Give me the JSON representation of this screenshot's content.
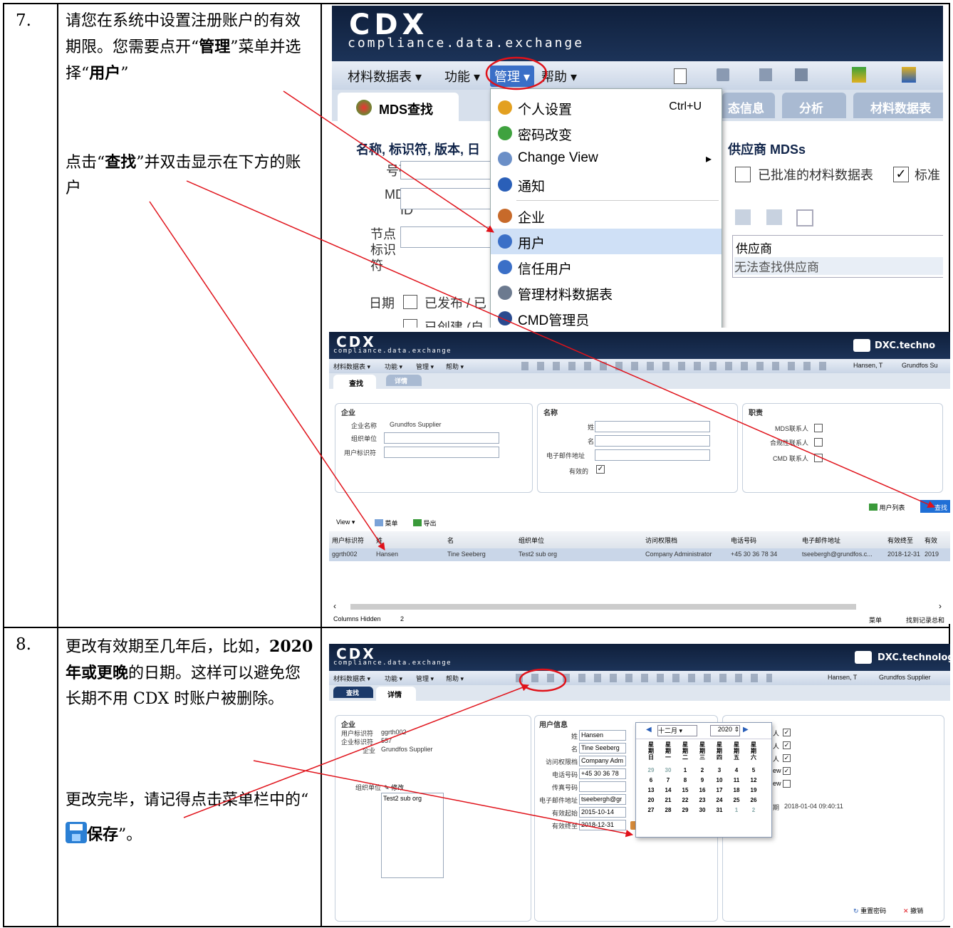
{
  "row7": {
    "number": "7.",
    "text_a_1": "请您在系统中设置注册账户的有效期限。您需要点开",
    "text_a_q1": "“",
    "text_a_b1": "管理",
    "text_a_2": "”菜单并选择",
    "text_a_q2": "“",
    "text_a_b2": "用户",
    "text_a_q3": "”",
    "text_b_1": "点击",
    "text_b_q1": "“",
    "text_b_b1": "查找",
    "text_b_2": "”并双击显示在下方的账户"
  },
  "row8": {
    "number": "8.",
    "text_a_1": "更改有效期至几年后，比如，",
    "text_a_b1": "2020 年或更晚",
    "text_a_2": "的日期。这样可以避免您长期不用 CDX 时账户被删除。",
    "text_b_1": "更改完毕，请记得点击菜单栏中的",
    "text_b_q1": "“",
    "text_b_b1": "保存",
    "text_b_2": "”。"
  },
  "logo": {
    "main": "CDX",
    "sub": "compliance.data.exchange",
    "brand": "DXC.techno",
    "brand2": "DXC.technolog"
  },
  "shot1": {
    "menu": [
      "材料数据表 ▾",
      "功能 ▾",
      "管理",
      "帮助 ▾"
    ],
    "tab_main": "MDS查找",
    "tab_info": "态信息",
    "tab_analysis": "分析",
    "tab_mds": "材料数据表",
    "section_title": "名称, 标识符, 版本, 日",
    "f_number": "号码",
    "f_mdsid": "MDS ID",
    "f_node": "节点标识符",
    "f_date": "日期",
    "f_published": "已发布 / 已",
    "f_created": "已创建 (自",
    "supplier_title": "供应商 MDSs",
    "approved": "已批准的材料数据表",
    "standard": "标准",
    "supplier_col": "供应商",
    "no_supplier": "无法查找供应商",
    "dropdown": [
      {
        "label": "个人设置",
        "shortcut": "Ctrl+U",
        "icon": "person-icon",
        "color": "#e3a020"
      },
      {
        "label": "密码改变",
        "shortcut": "",
        "icon": "key-people-icon",
        "color": "#3fa23f"
      },
      {
        "label": "Change View",
        "shortcut": "▸",
        "icon": "gear-icon",
        "color": "#6b8fc7"
      },
      {
        "label": "通知",
        "shortcut": "",
        "icon": "info-icon",
        "color": "#2a5fb8"
      },
      {
        "label": "企业",
        "shortcut": "",
        "icon": "home-icon",
        "color": "#c76a2a"
      },
      {
        "label": "用户",
        "shortcut": "",
        "icon": "user-icon",
        "color": "#3a6fc7"
      },
      {
        "label": "信任用户",
        "shortcut": "",
        "icon": "trusted-user-icon",
        "color": "#3a6fc7"
      },
      {
        "label": "管理材料数据表",
        "shortcut": "",
        "icon": "document-icon",
        "color": "#6c7a8f"
      },
      {
        "label": "CMD管理员",
        "shortcut": "",
        "icon": "admin-icon",
        "color": "#2a4a8f"
      }
    ]
  },
  "shot2": {
    "menu": [
      "材料数据表 ▾",
      "功能 ▾",
      "管理 ▾",
      "帮助 ▾"
    ],
    "user": "Hansen, T",
    "company": "Grundfos Su",
    "tab_find": "查找",
    "tab_detail": "详情",
    "p_company": "企业",
    "company_name_lbl": "企业名称",
    "company_name": "Grundfos Supplier",
    "org_lbl": "组织单位",
    "userid_lbl": "用户标识符",
    "p_name": "名称",
    "last_lbl": "姓",
    "first_lbl": "名",
    "email_lbl": "电子邮件地址",
    "valid_lbl": "有效的",
    "p_role": "职责",
    "role1": "MDS联系人",
    "role2": "合规性联系人",
    "role3": "CMD 联系人",
    "userlist": "用户列表",
    "find": "查找",
    "view": "View ▾",
    "menu_btn": "菜单",
    "export": "导出",
    "columns": [
      "用户标识符",
      "姓",
      "名",
      "组织单位",
      "访问权限档",
      "电话号码",
      "电子邮件地址",
      "有效终至",
      "有效"
    ],
    "row": [
      "ggrth002",
      "Hansen",
      "Tine Seeberg",
      "Test2 sub org",
      "Company Administrator",
      "+45 30 36 78 34",
      "tseebergh@grundfos.c...",
      "2018-12-31",
      "2019"
    ],
    "cols_hidden": "Columns Hidden",
    "cols_hidden_n": "2",
    "footer_menu": "菜单",
    "footer_total": "找到记录总和"
  },
  "shot3": {
    "menu": [
      "材料数据表 ▾",
      "功能 ▾",
      "管理 ▾",
      "帮助 ▾"
    ],
    "user": "Hansen, T",
    "company": "Grundfos Supplier",
    "tab_find": "查找",
    "tab_detail": "详情",
    "p_company": "企业",
    "userid_lbl": "用户标识符",
    "userid": "ggrth002",
    "compid_lbl": "企业标识符",
    "compid": "557",
    "comp_lbl": "企业",
    "comp": "Grundfos Supplier",
    "org_lbl": "组织单位",
    "edit": "修改",
    "org_val": "Test2 sub org",
    "p_user": "用户信息",
    "last_lbl": "姓",
    "last": "Hansen",
    "first_lbl": "名",
    "first": "Tine Seeberg",
    "access_lbl": "访问权限档",
    "access": "Company Adm",
    "phone_lbl": "电话号码",
    "phone": "+45 30 36 78",
    "fax_lbl": "传真号码",
    "email_lbl": "电子邮件地址",
    "email": "tseebergh@gr",
    "from_lbl": "有效起始",
    "from": "2015-10-14",
    "to_lbl": "有效终至",
    "to": "2018-12-31",
    "right_a": "人",
    "right_b": "人",
    "right_c": "人",
    "right_d": "ew",
    "right_e": "ew",
    "right_date_lbl": "期",
    "right_date": "2018-01-04 09:40:11",
    "cal_month": "十二月",
    "cal_year": "2020",
    "cal_days": [
      "星期日",
      "星期一",
      "星期二",
      "星期三",
      "星期四",
      "星期五",
      "星期六"
    ],
    "cal_weeks": [
      [
        "29",
        "30",
        "1",
        "2",
        "3",
        "4",
        "5"
      ],
      [
        "6",
        "7",
        "8",
        "9",
        "10",
        "11",
        "12"
      ],
      [
        "13",
        "14",
        "15",
        "16",
        "17",
        "18",
        "19"
      ],
      [
        "20",
        "21",
        "22",
        "23",
        "24",
        "25",
        "26"
      ],
      [
        "27",
        "28",
        "29",
        "30",
        "31",
        "1",
        "2"
      ]
    ],
    "reset_pwd": "重置密码",
    "cancel": "撤销"
  },
  "colors": {
    "arrow": "#e0121a",
    "header": "#14284a",
    "accent_blue": "#2a5fb8"
  }
}
